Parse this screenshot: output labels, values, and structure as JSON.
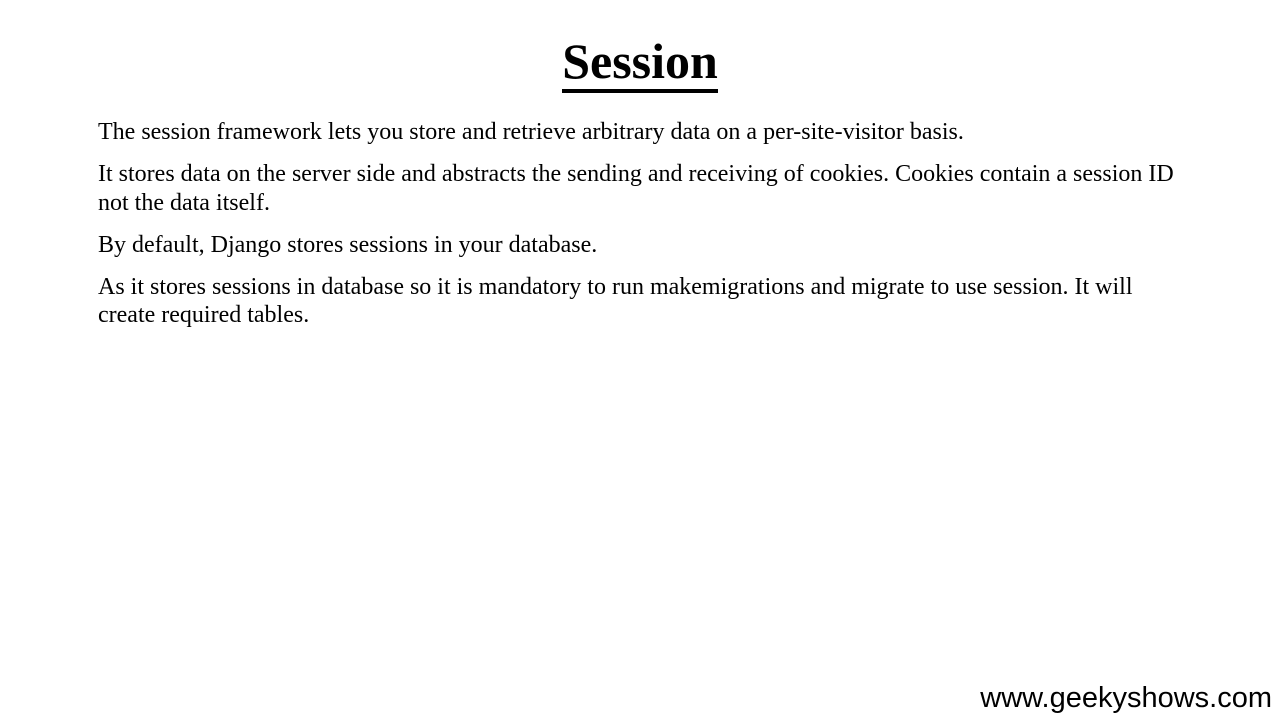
{
  "slide": {
    "title": "Session",
    "paragraphs": [
      "The session framework lets you store and retrieve arbitrary data on a per-site-visitor basis.",
      "It stores data on the server side and abstracts the sending and receiving of cookies. Cookies contain a session ID not the data itself.",
      "By default, Django stores sessions in your database.",
      "As it stores sessions in database so it is mandatory to run makemigrations and migrate to use session. It will create required tables."
    ]
  },
  "watermark": {
    "text": "www.geekyshows.com"
  }
}
